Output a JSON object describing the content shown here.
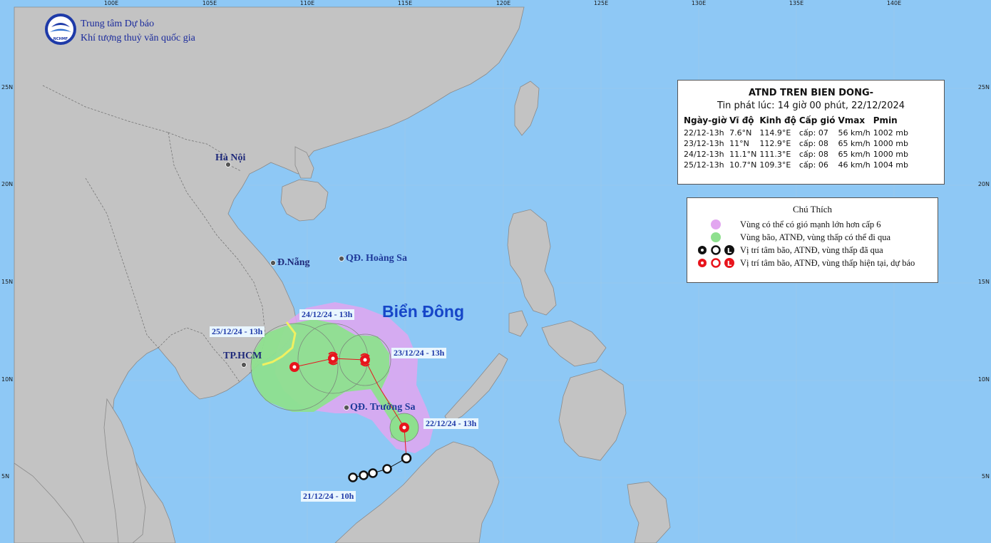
{
  "header": {
    "agency_line1": "Trung tâm Dự báo",
    "agency_line2": "Khí tượng thuỷ văn quốc gia",
    "logo_text": "NCHMF"
  },
  "axes": {
    "lon_labels": [
      "100E",
      "105E",
      "110E",
      "115E",
      "120E",
      "125E",
      "130E",
      "135E",
      "140E"
    ],
    "lat_labels_left": [
      "25N",
      "20N",
      "15N",
      "10N",
      "5N"
    ],
    "lat_labels_right": [
      "25N",
      "20N",
      "15N",
      "10N",
      "5N"
    ]
  },
  "places": {
    "hanoi": "Hà Nội",
    "danang": "Đ.Nẵng",
    "hcm": "TP.HCM",
    "hoangsa": "QĐ. Hoàng Sa",
    "truongsa": "QĐ. Trường Sa",
    "sea": "Biển Đông"
  },
  "track_labels": {
    "d21": "21/12/24 - 10h",
    "d22": "22/12/24 - 13h",
    "d23": "23/12/24 - 13h",
    "d24": "24/12/24 - 13h",
    "d25": "25/12/24 - 13h"
  },
  "bulletin": {
    "title": "ATND TREN BIEN DONG-",
    "issued": "Tin phát lúc: 14 giờ 00 phút, 22/12/2024",
    "headers": [
      "Ngày-giờ",
      "Vĩ độ",
      "Kinh độ",
      "Cấp gió",
      "Vmax",
      "Pmin"
    ],
    "rows": [
      [
        "22/12-13h",
        "7.6°N",
        "114.9°E",
        "cấp: 07",
        "56 km/h",
        "1002 mb"
      ],
      [
        "23/12-13h",
        "11°N",
        "112.9°E",
        "cấp: 08",
        "65 km/h",
        "1000 mb"
      ],
      [
        "24/12-13h",
        "11.1°N",
        "111.3°E",
        "cấp: 08",
        "65 km/h",
        "1000 mb"
      ],
      [
        "25/12-13h",
        "10.7°N",
        "109.3°E",
        "cấp: 06",
        "46 km/h",
        "1004 mb"
      ]
    ]
  },
  "legend": {
    "title": "Chú Thích",
    "items": [
      "Vùng có thể có gió mạnh lớn hơn cấp 6",
      "Vùng bão, ATNĐ, vùng thấp có thể đi qua",
      "Vị trí tâm bão, ATNĐ, vùng thấp đã qua",
      "Vị trí tâm bão, ATNĐ, vùng thấp hiện tại, dự báo"
    ]
  },
  "colors": {
    "sea": "#8ec8f5",
    "land": "#c3c3c3",
    "strong_wind_zone": "#e2a6f0",
    "cone": "#8ee08e",
    "forecast_marker": "#e8141c",
    "past_marker": "#111111"
  }
}
